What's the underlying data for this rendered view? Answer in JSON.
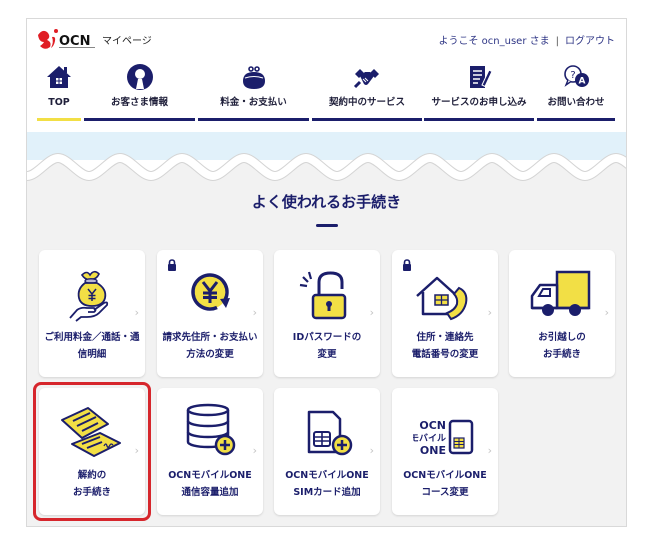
{
  "header": {
    "logo_brand": "OCN",
    "site_title": "マイページ",
    "welcome": "ようこそ ocn_user さま",
    "separator": "|",
    "logout": "ログアウト"
  },
  "nav": {
    "tabs": [
      {
        "label": "TOP",
        "icon": "home-icon",
        "active": true
      },
      {
        "label": "お客さま情報",
        "icon": "user-circle-icon",
        "active": false
      },
      {
        "label": "料金・お支払い",
        "icon": "coin-purse-icon",
        "active": false
      },
      {
        "label": "契約中のサービス",
        "icon": "handshake-icon",
        "active": false
      },
      {
        "label": "サービスのお申し込み",
        "icon": "document-pen-icon",
        "active": false
      },
      {
        "label": "お問い合わせ",
        "icon": "question-answer-icon",
        "active": false,
        "icon_glyphs": {
          "question": "?",
          "answer": "A"
        }
      }
    ]
  },
  "section": {
    "title": "よく使われるお手続き"
  },
  "cards": [
    {
      "lines": [
        "ご利用料金／通話・通",
        "信明細"
      ],
      "icon": "money-bag-icon",
      "locked": false,
      "highlighted": false
    },
    {
      "lines": [
        "請求先住所・お支払い",
        "方法の変更"
      ],
      "icon": "yen-cycle-icon",
      "locked": true,
      "highlighted": false
    },
    {
      "lines": [
        "IDパスワードの",
        "変更"
      ],
      "icon": "open-padlock-icon",
      "locked": false,
      "highlighted": false
    },
    {
      "lines": [
        "住所・連絡先",
        "電話番号の変更"
      ],
      "icon": "house-phone-icon",
      "locked": true,
      "highlighted": false
    },
    {
      "lines": [
        "お引越しの",
        "お手続き"
      ],
      "icon": "truck-icon",
      "locked": false,
      "highlighted": false
    },
    {
      "lines": [
        "解約の",
        "お手続き"
      ],
      "icon": "contract-papers-icon",
      "locked": false,
      "highlighted": true
    },
    {
      "lines": [
        "OCNモバイルONE",
        "通信容量追加"
      ],
      "icon": "database-plus-icon",
      "locked": false,
      "highlighted": false
    },
    {
      "lines": [
        "OCNモバイルONE",
        "SIMカード追加"
      ],
      "icon": "sim-plus-icon",
      "locked": false,
      "highlighted": false
    },
    {
      "lines": [
        "OCNモバイルONE",
        "コース変更"
      ],
      "icon": "ocn-mobile-one-sim-icon",
      "locked": false,
      "highlighted": false,
      "icon_text": [
        "OCN",
        "モバイル",
        "ONE"
      ]
    }
  ],
  "colors": {
    "navy": "#1b1e6b",
    "yellow": "#f2df45",
    "highlight_red": "#d6262c",
    "logo_red": "#e01e25",
    "wave_blue": "#e1f1fa",
    "section_gray": "#f2f2f2"
  }
}
